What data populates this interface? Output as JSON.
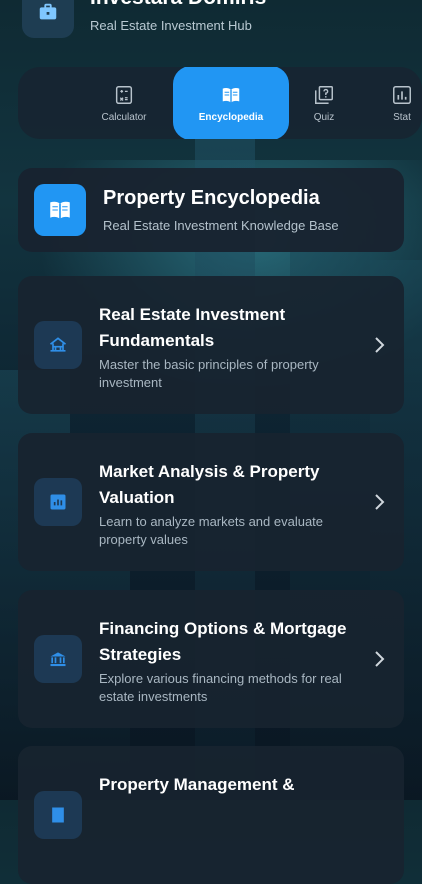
{
  "app": {
    "title": "Investara Domiris",
    "subtitle": "Real Estate Investment Hub",
    "logo_icon": "briefcase-icon"
  },
  "tabs": [
    {
      "label": "Calculator",
      "icon": "calculator-icon",
      "active": false
    },
    {
      "label": "Encyclopedia",
      "icon": "book-icon",
      "active": true
    },
    {
      "label": "Quiz",
      "icon": "quiz-icon",
      "active": false
    },
    {
      "label": "Stat",
      "icon": "stats-icon",
      "active": false
    }
  ],
  "hero": {
    "title": "Property Encyclopedia",
    "subtitle": "Real Estate Investment Knowledge Base",
    "icon": "book-icon"
  },
  "topics": [
    {
      "title": "Real Estate Investment Fundamentals",
      "description": "Master the basic principles of property investment",
      "icon": "house-icon"
    },
    {
      "title": "Market Analysis & Property Valuation",
      "description": "Learn to analyze markets and evaluate property values",
      "icon": "chart-icon"
    },
    {
      "title": "Financing Options & Mortgage Strategies",
      "description": "Explore various financing methods for real estate investments",
      "icon": "bank-icon"
    },
    {
      "title": "Property Management &",
      "description": "",
      "icon": "building-icon"
    }
  ],
  "colors": {
    "accent": "#2196f3",
    "card_bg": "#18232f",
    "icon_bg": "#1d3954"
  }
}
